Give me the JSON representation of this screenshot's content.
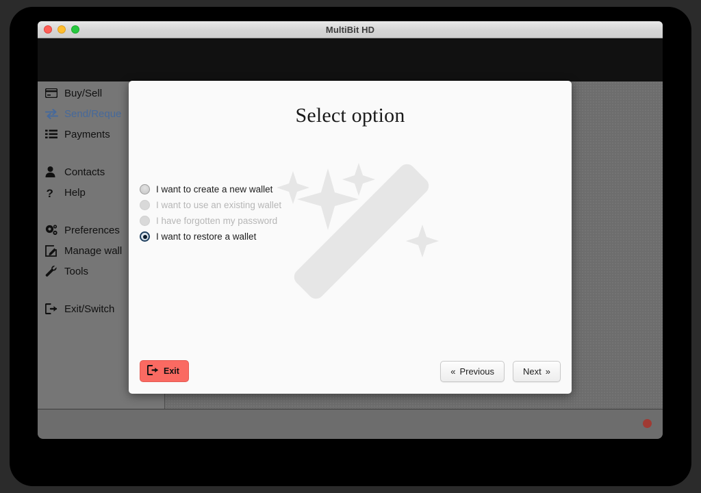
{
  "window": {
    "title": "MultiBit HD",
    "traffic_lights": [
      "close",
      "minimize",
      "maximize"
    ]
  },
  "sidebar": {
    "items": [
      {
        "label": "Buy/Sell",
        "icon": "credit-card-icon",
        "active": false
      },
      {
        "label": "Send/Reque",
        "icon": "exchange-icon",
        "active": true
      },
      {
        "label": "Payments",
        "icon": "list-icon",
        "active": false
      },
      {
        "label": "Contacts",
        "icon": "person-icon",
        "active": false
      },
      {
        "label": "Help",
        "icon": "question-mark-icon",
        "active": false
      },
      {
        "label": "Preferences",
        "icon": "gears-icon",
        "active": false
      },
      {
        "label": "Manage wall",
        "icon": "edit-square-icon",
        "active": false
      },
      {
        "label": "Tools",
        "icon": "wrench-icon",
        "active": false
      },
      {
        "label": "Exit/Switch",
        "icon": "exit-icon",
        "active": false
      }
    ]
  },
  "wizard": {
    "title": "Select option",
    "watermark": "magic-wand-sparkles",
    "options": [
      {
        "label": "I want to create a new wallet",
        "selected": false,
        "disabled": false
      },
      {
        "label": "I want to use an existing wallet",
        "selected": false,
        "disabled": true
      },
      {
        "label": "I have forgotten my password",
        "selected": false,
        "disabled": true
      },
      {
        "label": "I want to restore a wallet",
        "selected": true,
        "disabled": false
      }
    ],
    "buttons": {
      "exit": "Exit",
      "previous": "Previous",
      "next": "Next",
      "previous_chevron": "«",
      "next_chevron": "»"
    }
  },
  "status_bar": {
    "indicator": "red-status-dot"
  },
  "colors": {
    "accent_blue": "#46699b",
    "exit_red": "#fa6a62",
    "status_red": "#a03a33",
    "sidebar_gray": "#767676",
    "header_black": "#111111"
  }
}
